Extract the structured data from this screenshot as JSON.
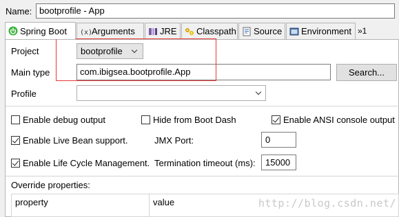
{
  "name": {
    "label": "Name:",
    "value": "bootprofile - App"
  },
  "tabs": [
    {
      "label": "Spring Boot",
      "icon": "spring-boot-icon"
    },
    {
      "label": "Arguments",
      "icon": "arguments-icon"
    },
    {
      "label": "JRE",
      "icon": "jre-icon"
    },
    {
      "label": "Classpath",
      "icon": "classpath-icon"
    },
    {
      "label": "Source",
      "icon": "source-icon"
    },
    {
      "label": "Environment",
      "icon": "environment-icon"
    },
    {
      "label": "»1",
      "icon": "overflow-icon"
    }
  ],
  "project": {
    "label": "Project",
    "value": "bootprofile"
  },
  "main_type": {
    "label": "Main type",
    "value": "com.ibigsea.bootprofile.App",
    "button": "Search..."
  },
  "profile": {
    "label": "Profile",
    "value": ""
  },
  "checks": {
    "debug": {
      "label": "Enable debug output",
      "checked": false
    },
    "hide": {
      "label": "Hide from Boot Dash",
      "checked": false
    },
    "ansi": {
      "label": "Enable ANSI console output",
      "checked": true
    },
    "live_bean": {
      "label": "Enable Live Bean support.",
      "checked": true
    },
    "life_cycle": {
      "label": "Enable Life Cycle Management.",
      "checked": true
    }
  },
  "jmx": {
    "label": "JMX Port:",
    "value": "0"
  },
  "termination": {
    "label": "Termination timeout (ms):",
    "value": "15000"
  },
  "override": {
    "label": "Override properties:",
    "columns": [
      "property",
      "value"
    ]
  },
  "watermark": "http://blog.csdn.net/",
  "colors": {
    "highlight": "#e53935",
    "spring_green": "#3bb33b"
  }
}
